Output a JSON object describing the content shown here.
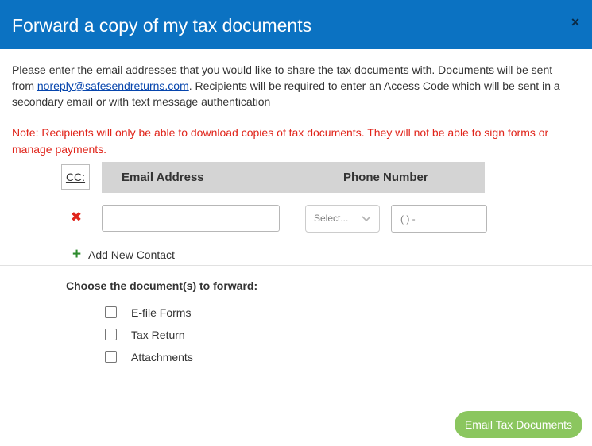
{
  "dialog": {
    "title": "Forward a copy of my tax documents",
    "close_glyph": "×",
    "header_color": "#0b72c2"
  },
  "intro": {
    "text_before": "Please enter the email addresses that you would like to share the tax documents with. Documents will be sent from ",
    "email_link": "noreply@safesendreturns.com",
    "text_after": ". Recipients will be required to enter an Access Code which will be sent in a secondary email or with text message authentication"
  },
  "note": "Note: Recipients will only be able to download copies of tax documents. They will not be able to sign forms or manage payments.",
  "contacts": {
    "cc_label": "CC:",
    "email_header": "Email Address",
    "phone_header": "Phone Number",
    "rows": [
      {
        "email_value": "",
        "country_select": "Select...",
        "phone_placeholder": "( ) -"
      }
    ],
    "add_label": "Add New Contact"
  },
  "documents": {
    "heading": "Choose the document(s) to forward:",
    "options": [
      {
        "label": "E-file Forms",
        "checked": false
      },
      {
        "label": "Tax Return",
        "checked": false
      },
      {
        "label": "Attachments",
        "checked": false
      }
    ]
  },
  "footer": {
    "submit_label": "Email Tax Documents",
    "submit_color": "#8bc65f"
  },
  "icons": {
    "close": "close-icon",
    "remove": "remove-contact-icon",
    "add": "plus-icon",
    "dropdown": "chevron-down-icon"
  }
}
